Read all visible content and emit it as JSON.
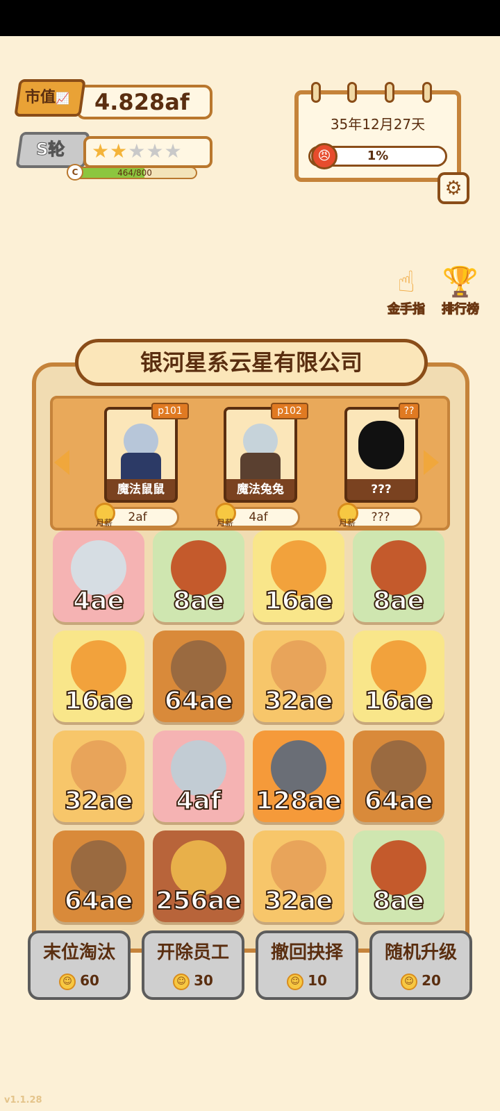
{
  "market_value": {
    "label": "市值",
    "value": "4.828af"
  },
  "round": {
    "label": "S轮",
    "stars_filled": 2,
    "stars_total": 5,
    "xp_text": "464/800",
    "xp_fraction": 0.58,
    "xp_badge": "C"
  },
  "calendar": {
    "date": "35年12月27天",
    "anger_percent": "1%"
  },
  "side_buttons": {
    "golden_finger": "金手指",
    "leaderboard": "排行榜"
  },
  "company": {
    "name": "银河星系云星有限公司"
  },
  "hire_cards": [
    {
      "tag": "p101",
      "name": "魔法鼠鼠",
      "salary": "2af",
      "salary_label": "月薪"
    },
    {
      "tag": "p102",
      "name": "魔法兔兔",
      "salary": "4af",
      "salary_label": "月薪"
    },
    {
      "tag": "??",
      "name": "???",
      "salary": "???",
      "salary_label": "月薪"
    }
  ],
  "tiles": [
    {
      "value": "4ae",
      "animal": "rabbit",
      "bg": "#f5b3b3"
    },
    {
      "value": "8ae",
      "animal": "red-panda",
      "bg": "#cfe6b0"
    },
    {
      "value": "16ae",
      "animal": "orange-cat",
      "bg": "#f9e68a"
    },
    {
      "value": "8ae",
      "animal": "red-panda",
      "bg": "#cfe6b0"
    },
    {
      "value": "16ae",
      "animal": "orange-cat",
      "bg": "#f9e68a"
    },
    {
      "value": "64ae",
      "animal": "bear",
      "bg": "#d98a3a"
    },
    {
      "value": "32ae",
      "animal": "shiba",
      "bg": "#f7c66a"
    },
    {
      "value": "16ae",
      "animal": "orange-cat",
      "bg": "#f9e68a"
    },
    {
      "value": "32ae",
      "animal": "shiba",
      "bg": "#f7c66a"
    },
    {
      "value": "4af",
      "animal": "wizard-rabbit",
      "bg": "#f5b3b3"
    },
    {
      "value": "128ae",
      "animal": "wolf",
      "bg": "#f59a3a"
    },
    {
      "value": "64ae",
      "animal": "bear",
      "bg": "#d98a3a"
    },
    {
      "value": "64ae",
      "animal": "bear",
      "bg": "#d98a3a"
    },
    {
      "value": "256ae",
      "animal": "leopard",
      "bg": "#b8643a"
    },
    {
      "value": "32ae",
      "animal": "shiba",
      "bg": "#f7c66a"
    },
    {
      "value": "8ae",
      "animal": "red-panda",
      "bg": "#cfe6b0"
    }
  ],
  "actions": [
    {
      "label": "末位淘汰",
      "cost": "60"
    },
    {
      "label": "开除员工",
      "cost": "30"
    },
    {
      "label": "撤回抉择",
      "cost": "10"
    },
    {
      "label": "随机升级",
      "cost": "20"
    }
  ],
  "version": "v1.1.28",
  "colors": {
    "background": "#fcf0d6",
    "panel": "#f1dcb2",
    "border": "#c5833a",
    "dark_brown": "#5a2e10"
  }
}
